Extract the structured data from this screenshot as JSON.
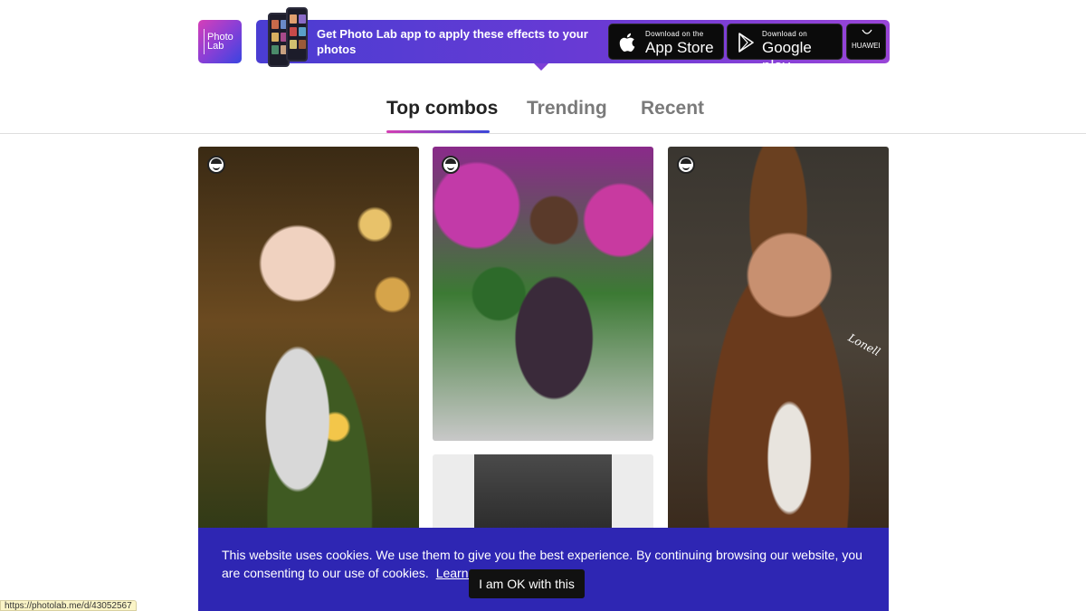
{
  "banner": {
    "logo_line1": "Photo",
    "logo_line2": "Lab",
    "text": "Get Photo Lab app to apply these effects to your photos",
    "apple_small": "Download on the",
    "apple_big": "App Store",
    "apple_icon": "apple-logo-icon",
    "google_small": "Download on",
    "google_big": "Google play",
    "google_icon": "google-play-icon",
    "huawei_label": "HUAWEI"
  },
  "tabs": [
    {
      "label": "Top combos",
      "active": true
    },
    {
      "label": "Trending",
      "active": false
    },
    {
      "label": "Recent",
      "active": false
    }
  ],
  "cards": {
    "card4_signature": "Lonell",
    "face_icon": "face-icon"
  },
  "cookie": {
    "text": "This website uses cookies. We use them to give you the best experience. By continuing browsing our website, you are consenting to our use of cookies.",
    "learn_more": "Learn more",
    "ok_button": "I am OK with this"
  },
  "status_url": "https://photolab.me/d/43052567",
  "colors": {
    "accent": "#2e26b3",
    "tab_gradient_start": "#d43fb3",
    "tab_gradient_end": "#3b45d8"
  }
}
